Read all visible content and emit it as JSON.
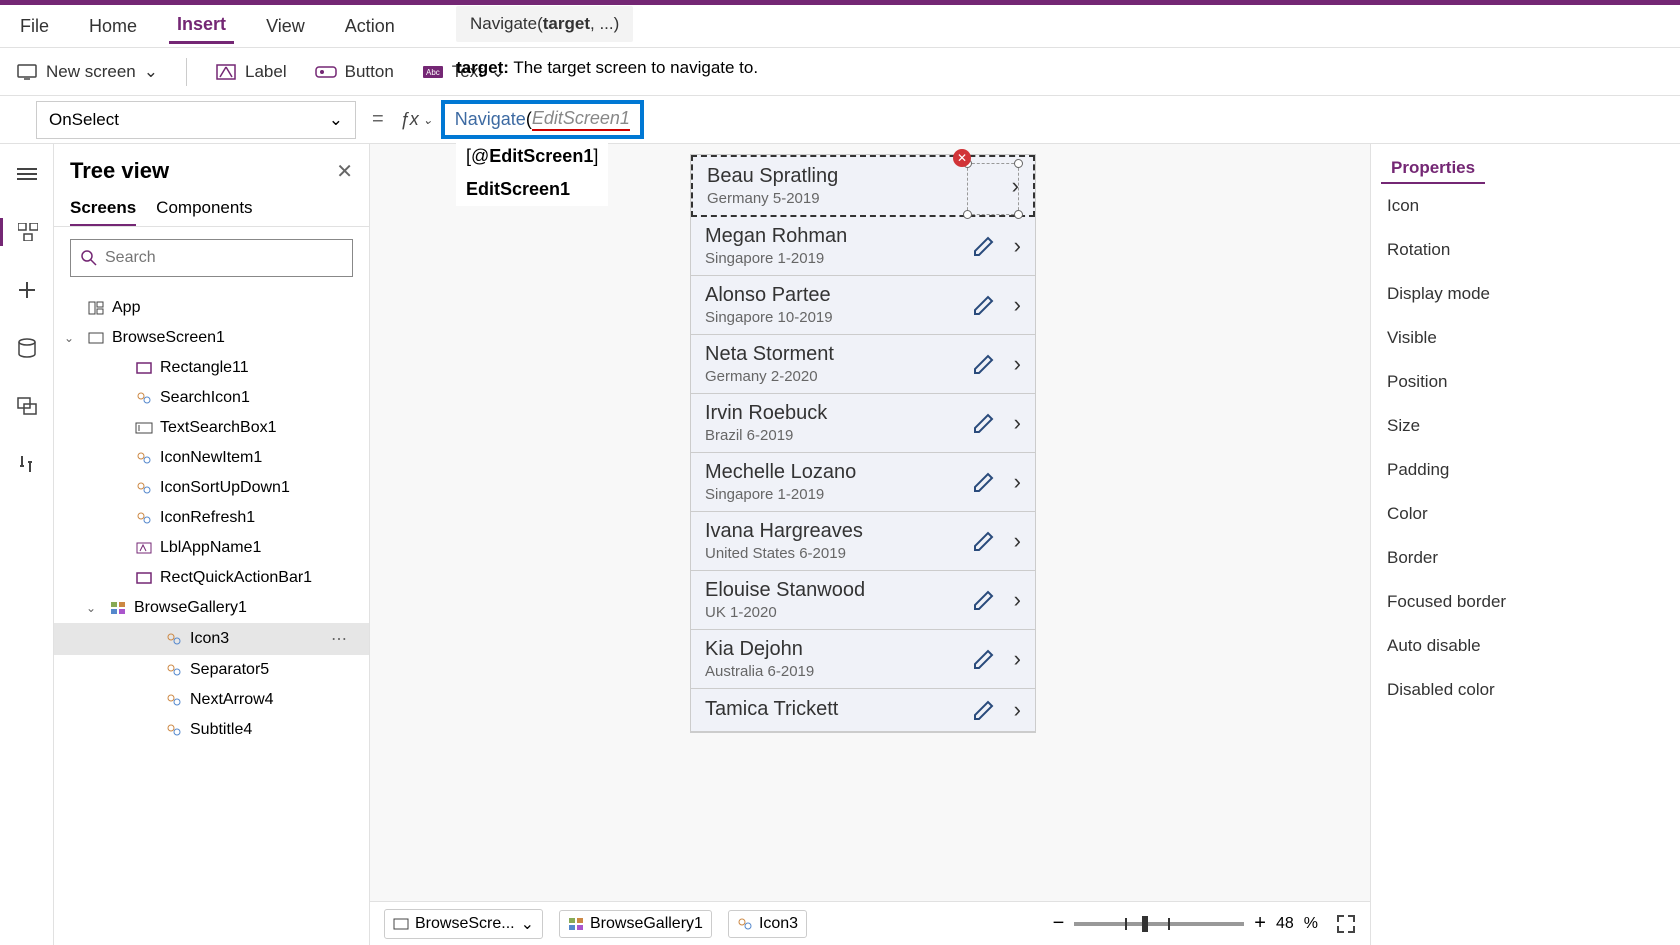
{
  "menu": {
    "file": "File",
    "home": "Home",
    "insert": "Insert",
    "view": "View",
    "action": "Action"
  },
  "ribbon": {
    "newScreen": "New screen",
    "label": "Label",
    "button": "Button",
    "text": "Text"
  },
  "formulaHint": {
    "sig": "Navigate(",
    "sigBold": "target",
    "sigTail": ", ...)",
    "helpKey": "target:",
    "helpText": " The target screen to navigate to."
  },
  "propSelect": "OnSelect",
  "formula": {
    "fn": "Navigate",
    "paren": "(",
    "arg": "EditScreen1"
  },
  "autocomplete": {
    "item1a": "[@",
    "item1b": "EditScreen1",
    "item1c": "]",
    "item2": "EditScreen1"
  },
  "treePanel": {
    "title": "Tree view",
    "tabScreens": "Screens",
    "tabComponents": "Components",
    "searchPlaceholder": "Search",
    "app": "App",
    "nodes": [
      {
        "label": "BrowseScreen1",
        "type": "screen"
      },
      {
        "label": "Rectangle11",
        "type": "rect"
      },
      {
        "label": "SearchIcon1",
        "type": "icon"
      },
      {
        "label": "TextSearchBox1",
        "type": "textbox"
      },
      {
        "label": "IconNewItem1",
        "type": "icon"
      },
      {
        "label": "IconSortUpDown1",
        "type": "icon"
      },
      {
        "label": "IconRefresh1",
        "type": "icon"
      },
      {
        "label": "LblAppName1",
        "type": "label"
      },
      {
        "label": "RectQuickActionBar1",
        "type": "rect"
      }
    ],
    "gallery": "BrowseGallery1",
    "galleryChildren": [
      {
        "label": "Icon3",
        "selected": true
      },
      {
        "label": "Separator5"
      },
      {
        "label": "NextArrow4"
      },
      {
        "label": "Subtitle4"
      }
    ]
  },
  "listItems": [
    {
      "name": "Beau Spratling",
      "sub": "Germany 5-2019"
    },
    {
      "name": "Megan Rohman",
      "sub": "Singapore 1-2019"
    },
    {
      "name": "Alonso Partee",
      "sub": "Singapore 10-2019"
    },
    {
      "name": "Neta Storment",
      "sub": "Germany 2-2020"
    },
    {
      "name": "Irvin Roebuck",
      "sub": "Brazil 6-2019"
    },
    {
      "name": "Mechelle Lozano",
      "sub": "Singapore 1-2019"
    },
    {
      "name": "Ivana Hargreaves",
      "sub": "United States 6-2019"
    },
    {
      "name": "Elouise Stanwood",
      "sub": "UK 1-2020"
    },
    {
      "name": "Kia Dejohn",
      "sub": "Australia 6-2019"
    },
    {
      "name": "Tamica Trickett",
      "sub": ""
    }
  ],
  "props": {
    "tab": "Properties",
    "rows": [
      "Icon",
      "Rotation",
      "Display mode",
      "Visible",
      "Position",
      "Size",
      "Padding",
      "Color",
      "Border",
      "Focused border",
      "Auto disable",
      "Disabled color"
    ]
  },
  "statusBar": {
    "crumbs": [
      "BrowseScre...",
      "BrowseGallery1",
      "Icon3"
    ],
    "zoom": "48",
    "zoomPct": "%"
  },
  "icons": {
    "errorX": "✕",
    "plus": "+",
    "minus": "−",
    "chevDown": "⌄",
    "chevRight": "›"
  }
}
